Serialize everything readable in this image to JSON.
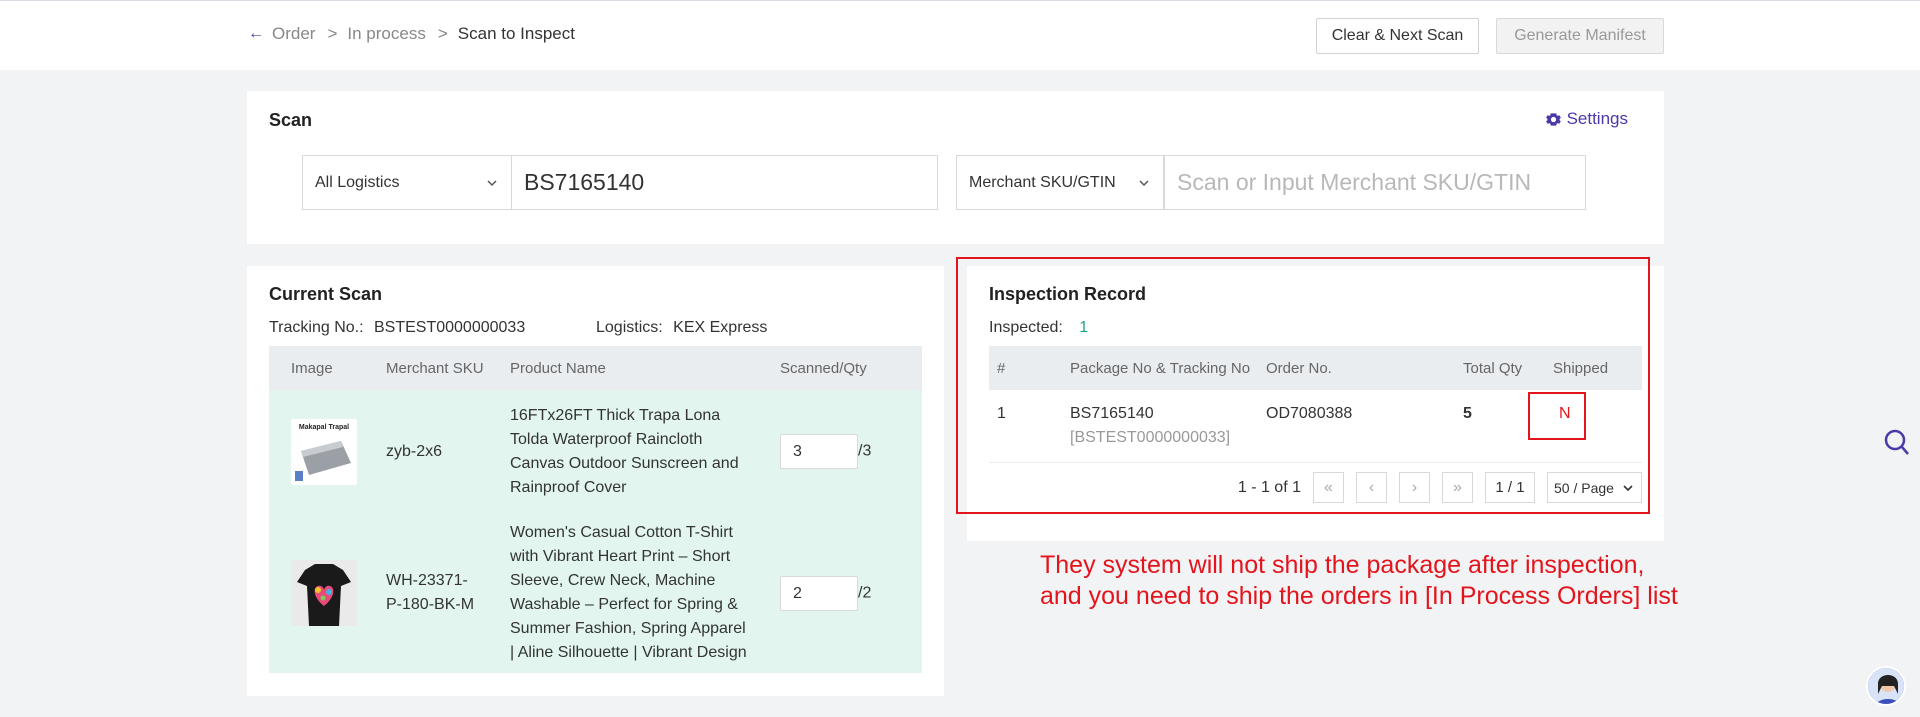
{
  "breadcrumb": {
    "items": [
      "Order",
      "In process",
      "Scan to Inspect"
    ]
  },
  "header": {
    "clear_next_label": "Clear & Next Scan",
    "generate_manifest_label": "Generate Manifest"
  },
  "scan": {
    "title": "Scan",
    "settings_label": "Settings",
    "logistics_select": "All Logistics",
    "tracking_value": "BS7165140",
    "sku_type_select": "Merchant SKU/GTIN",
    "sku_placeholder": "Scan or Input Merchant SKU/GTIN"
  },
  "current_scan": {
    "title": "Current Scan",
    "tracking_label": "Tracking No.:",
    "tracking_value": "BSTEST0000000033",
    "logistics_label": "Logistics:",
    "logistics_value": "KEX Express",
    "columns": [
      "Image",
      "Merchant SKU",
      "Product Name",
      "Scanned/Qty"
    ],
    "rows": [
      {
        "image_icon": "tarpaulin-product-image",
        "thumb_text": "Makapal Trapal",
        "sku": "zyb-2x6",
        "product_name": "16FTx26FT Thick Trapa Lona Tolda Waterproof Raincloth Canvas Outdoor Sunscreen and Rainproof Cover",
        "scanned": "3",
        "qty": "/3"
      },
      {
        "image_icon": "heart-tshirt-product-image",
        "sku": "WH-23371-P-180-BK-M",
        "product_name": "Women's Casual Cotton T-Shirt with Vibrant Heart Print – Short Sleeve, Crew Neck, Machine Washable – Perfect for Spring & Summer Fashion, Spring Apparel | Aline Silhouette | Vibrant Design",
        "scanned": "2",
        "qty": "/2"
      }
    ]
  },
  "inspection_record": {
    "title": "Inspection Record",
    "inspected_label": "Inspected:",
    "inspected_count": "1",
    "columns": [
      "#",
      "Package No & Tracking No",
      "Order No.",
      "Total Qty",
      "Shipped"
    ],
    "rows": [
      {
        "index": "1",
        "package_no": "BS7165140",
        "tracking_no": "[BSTEST0000000033]",
        "order_no": "OD7080388",
        "total_qty": "5",
        "shipped": "N"
      }
    ],
    "pagination": {
      "range": "1 - 1 of 1",
      "page": "1 / 1",
      "page_size": "50 / Page"
    }
  },
  "annotation": {
    "line1": "They system will not ship the package after inspection,",
    "line2": "and you need to ship the orders in [In Process Orders] list"
  },
  "colors": {
    "accent": "#4a3aa8",
    "highlight_red": "#e3141c",
    "row_green": "#e2f6ef",
    "inspected_count": "#1ba784"
  }
}
